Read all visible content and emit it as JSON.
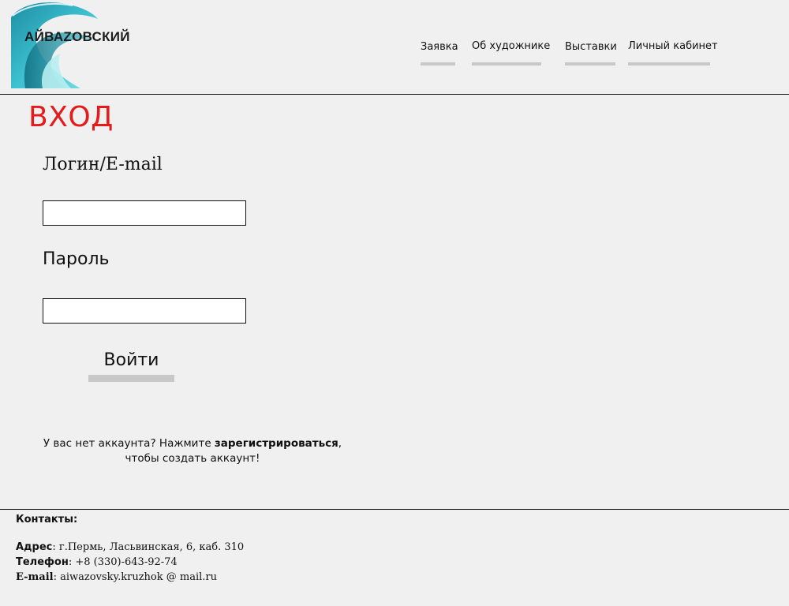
{
  "header": {
    "logo_text": "АЙВАZОВСКИЙ",
    "nav": [
      {
        "label": "Заявка"
      },
      {
        "label": "Об художнике"
      },
      {
        "label": "Выставки"
      },
      {
        "label": "Личный кабинет"
      }
    ]
  },
  "login": {
    "title": "ВХОД",
    "login_label": "Логин/E-mail",
    "login_value": "",
    "password_label": "Пароль",
    "password_value": "",
    "submit_label": "Войти",
    "register_prefix": "У вас нет аккаунта? Нажмите ",
    "register_link": "зарегистрироваться",
    "register_suffix": ",",
    "register_line2": "чтобы создать аккаунт!"
  },
  "footer": {
    "heading": "Контакты:",
    "address_label": "Адрес",
    "address_value": ": г.Пермь, Ласьвинская, 6, каб. 310",
    "phone_label": "Телефон",
    "phone_value": ": +8 (330)-643-92-74",
    "email_label": "E-mail",
    "email_value": ": aiwazovsky.kruzhok @ mail.ru"
  },
  "colors": {
    "title": "#e51b1b",
    "nav_bar": "#c8c8c8",
    "logo_wave": "#2aaec0"
  }
}
